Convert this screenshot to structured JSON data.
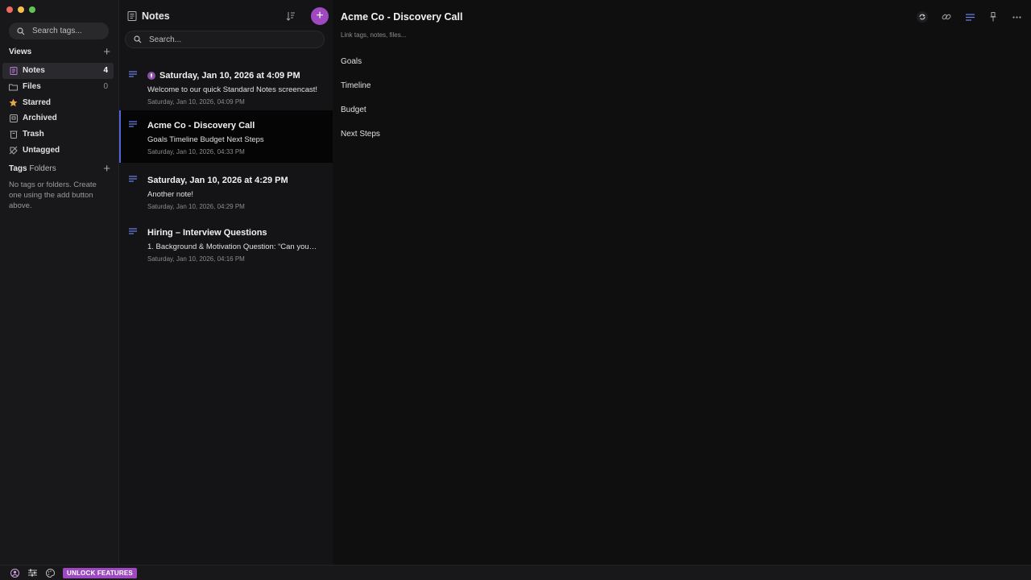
{
  "sidebar": {
    "tag_search_placeholder": "Search tags...",
    "views_title": "Views",
    "views": [
      {
        "label": "Notes",
        "count": "4",
        "icon": "notes-icon",
        "active": true
      },
      {
        "label": "Files",
        "count": "0",
        "icon": "folder-icon"
      },
      {
        "label": "Starred",
        "count": "",
        "icon": "star-icon"
      },
      {
        "label": "Archived",
        "count": "",
        "icon": "archive-icon"
      },
      {
        "label": "Trash",
        "count": "",
        "icon": "trash-icon"
      },
      {
        "label": "Untagged",
        "count": "",
        "icon": "untagged-icon"
      }
    ],
    "tags_title": "Tags",
    "folders_title": "Folders",
    "empty_tags_text": "No tags or folders. Create one using the add button above."
  },
  "notes_list": {
    "title": "Notes",
    "search_placeholder": "Search...",
    "notes": [
      {
        "title": "Saturday, Jan 10, 2026 at 4:09 PM",
        "preview": "Welcome to our quick Standard Notes screencast!",
        "date": "Saturday, Jan 10, 2026, 04:09 PM",
        "pinned": true
      },
      {
        "title": "Acme Co - Discovery Call",
        "preview": "Goals Timeline Budget Next Steps",
        "date": "Saturday, Jan 10, 2026, 04:33 PM",
        "selected": true
      },
      {
        "title": "Saturday, Jan 10, 2026 at 4:29 PM",
        "preview": "Another note!",
        "date": "Saturday, Jan 10, 2026, 04:29 PM"
      },
      {
        "title": "Hiring – Interview Questions",
        "preview": "1. Background & Motivation Question: “Can you…",
        "date": "Saturday, Jan 10, 2026, 04:16 PM"
      }
    ]
  },
  "editor": {
    "title": "Acme Co - Discovery Call",
    "link_placeholder": "Link tags, notes, files...",
    "lines": [
      "Goals",
      "Timeline",
      "Budget",
      "Next Steps"
    ]
  },
  "bottom_bar": {
    "unlock_label": "UNLOCK FEATURES"
  },
  "colors": {
    "accent": "#9f49c1",
    "selection_border": "#4f66d9",
    "note_icon": "#6b83e8"
  }
}
